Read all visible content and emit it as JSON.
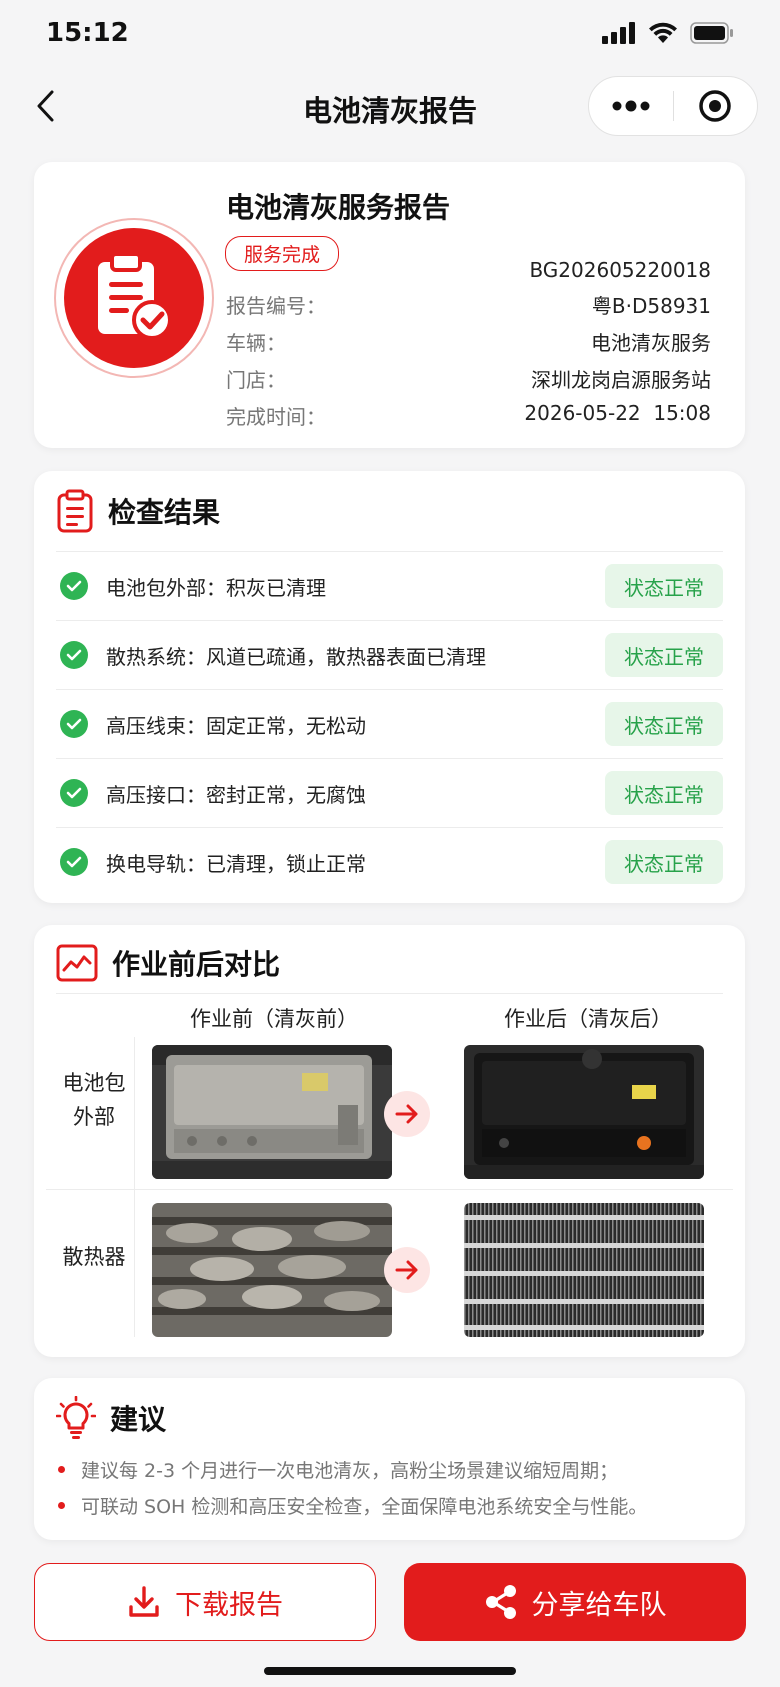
{
  "status_bar": {
    "time": "15:12"
  },
  "nav": {
    "title": "电池清灰报告"
  },
  "report": {
    "title": "电池清灰服务报告",
    "status_badge": "服务完成",
    "report_no": "BG202605220018",
    "fields": [
      {
        "label": "报告编号：",
        "value": "粤B·D58931"
      },
      {
        "label": "车辆：",
        "value": "电池清灰服务"
      },
      {
        "label": "门店：",
        "value": "深圳龙岗启源服务站"
      },
      {
        "label": "完成时间：",
        "value": "2026-05-22  15:08"
      }
    ]
  },
  "check": {
    "title": "检查结果",
    "items": [
      {
        "text": "电池包外部：积灰已清理",
        "status": "状态正常"
      },
      {
        "text": "散热系统：风道已疏通，散热器表面已清理",
        "status": "状态正常"
      },
      {
        "text": "高压线束：固定正常，无松动",
        "status": "状态正常"
      },
      {
        "text": "高压接口：密封正常，无腐蚀",
        "status": "状态正常"
      },
      {
        "text": "换电导轨：已清理，锁止正常",
        "status": "状态正常"
      }
    ]
  },
  "compare": {
    "title": "作业前后对比",
    "before_title": "作业前（清灰前）",
    "after_title": "作业后（清灰后）",
    "rows": [
      {
        "label_line1": "电池包",
        "label_line2": "外部"
      },
      {
        "label_line1": "散热器",
        "label_line2": ""
      }
    ]
  },
  "advice": {
    "title": "建议",
    "items": [
      "建议每 2-3 个月进行一次电池清灰，高粉尘场景建议缩短周期；",
      "可联动 SOH 检测和高压安全检查，全面保障电池系统安全与性能。"
    ]
  },
  "actions": {
    "download": "下载报告",
    "share": "分享给车队"
  },
  "colors": {
    "accent": "#e21c1c",
    "ok_green": "#2fb454",
    "ok_bg": "#e7f6e9"
  }
}
